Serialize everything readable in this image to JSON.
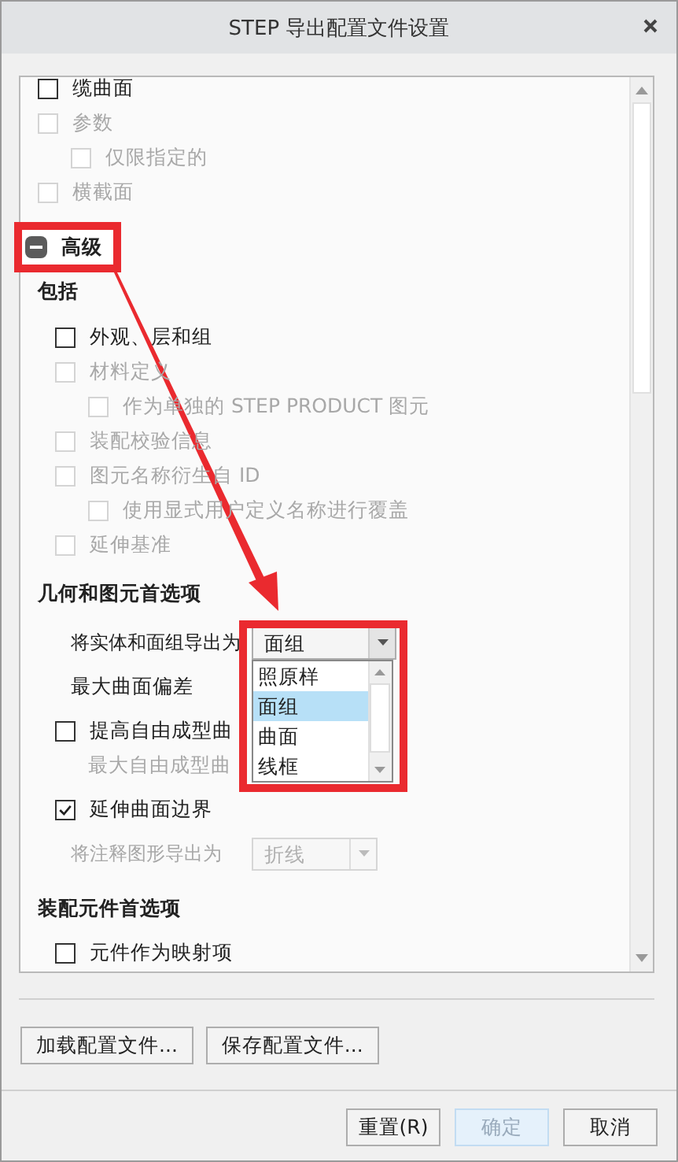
{
  "window": {
    "title": "STEP 导出配置文件设置"
  },
  "top_items": [
    {
      "label": "缆曲面",
      "checked": false,
      "disabled": false
    },
    {
      "label": "参数",
      "checked": false,
      "disabled": true,
      "children": [
        {
          "label": "仅限指定的",
          "checked": false,
          "disabled": true
        }
      ]
    },
    {
      "label": "横截面",
      "checked": false,
      "disabled": true
    }
  ],
  "advanced": {
    "label": "高级",
    "expanded": true
  },
  "include": {
    "heading": "包括",
    "items": [
      {
        "label": "外观、层和组",
        "checked": false,
        "disabled": false
      },
      {
        "label": "材料定义",
        "checked": false,
        "disabled": true,
        "children": [
          {
            "label": "作为单独的 STEP PRODUCT 图元",
            "checked": false,
            "disabled": true
          }
        ]
      },
      {
        "label": "装配校验信息",
        "checked": false,
        "disabled": true
      },
      {
        "label": "图元名称衍生自 ID",
        "checked": false,
        "disabled": true,
        "children": [
          {
            "label": "使用显式用户定义名称进行覆盖",
            "checked": false,
            "disabled": true
          }
        ]
      },
      {
        "label": "延伸基准",
        "checked": false,
        "disabled": true
      }
    ]
  },
  "geometry": {
    "heading": "几何和图元首选项",
    "rows": [
      {
        "kind": "select",
        "label": "将实体和面组导出为",
        "value": "面组",
        "disabled": false,
        "expanded": true,
        "options": [
          {
            "label": "照原样",
            "selected": false
          },
          {
            "label": "面组",
            "selected": true
          },
          {
            "label": "曲面",
            "selected": false
          },
          {
            "label": "线框",
            "selected": false
          }
        ]
      },
      {
        "kind": "label",
        "label": "最大曲面偏差",
        "disabled": false
      },
      {
        "kind": "checkbox",
        "label": "提高自由成型曲",
        "checked": false,
        "disabled": false,
        "children": [
          {
            "kind": "label",
            "label": "最大自由成型曲",
            "disabled": true
          }
        ]
      },
      {
        "kind": "checkbox",
        "label": "延伸曲面边界",
        "checked": true,
        "disabled": false
      },
      {
        "kind": "select",
        "label": "将注释图形导出为",
        "value": "折线",
        "disabled": true,
        "expanded": false
      }
    ]
  },
  "assembly": {
    "heading": "装配元件首选项",
    "items": [
      {
        "label": "元件作为映射项",
        "checked": false,
        "disabled": false
      }
    ]
  },
  "file_buttons": [
    "加载配置文件...",
    "保存配置文件..."
  ],
  "footer_buttons": [
    {
      "label": "重置(R)",
      "default": false
    },
    {
      "label": "确定",
      "default": true
    },
    {
      "label": "取消",
      "default": false
    }
  ]
}
